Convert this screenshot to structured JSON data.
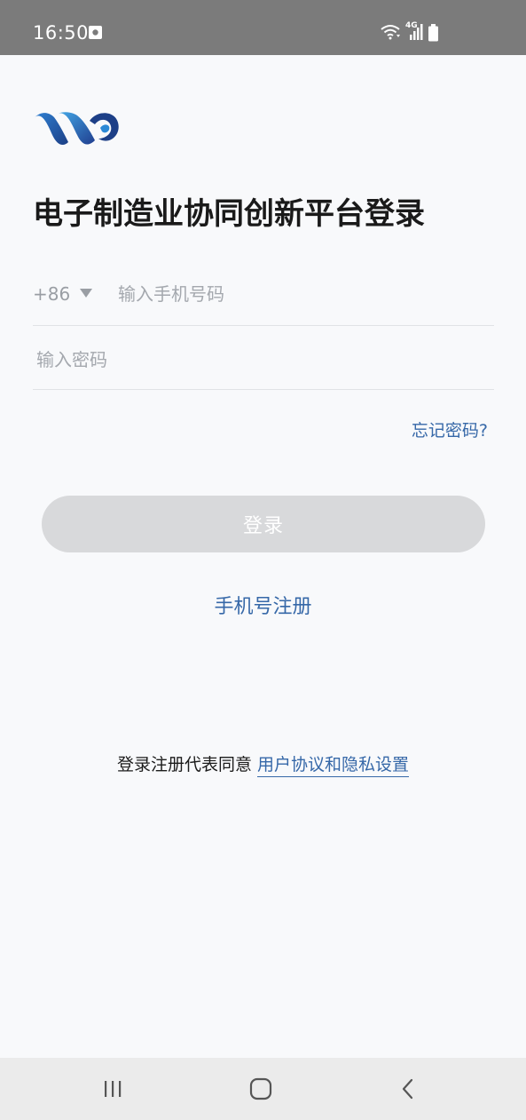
{
  "status_bar": {
    "time": "16:50",
    "icons": [
      "notification-icon",
      "wifi-icon",
      "signal-4g-icon",
      "battery-icon"
    ],
    "network_label": "4G"
  },
  "colors": {
    "accent": "#3668a8",
    "status_bar_bg": "#7b7b7b",
    "button_disabled": "#d8d9db",
    "page_bg": "#f8f9fb"
  },
  "title": "电子制造业协同创新平台登录",
  "form": {
    "country_code": "+86",
    "phone_placeholder": "输入手机号码",
    "phone_value": "",
    "password_placeholder": "输入密码",
    "password_value": "",
    "forgot_password": "忘记密码?",
    "login_button": "登录",
    "register_link": "手机号注册"
  },
  "agreement": {
    "prefix": "登录注册代表同意",
    "link": "用户协议和隐私设置"
  },
  "nav_bar": {
    "buttons": [
      "recent-apps-icon",
      "home-icon",
      "back-icon"
    ]
  }
}
